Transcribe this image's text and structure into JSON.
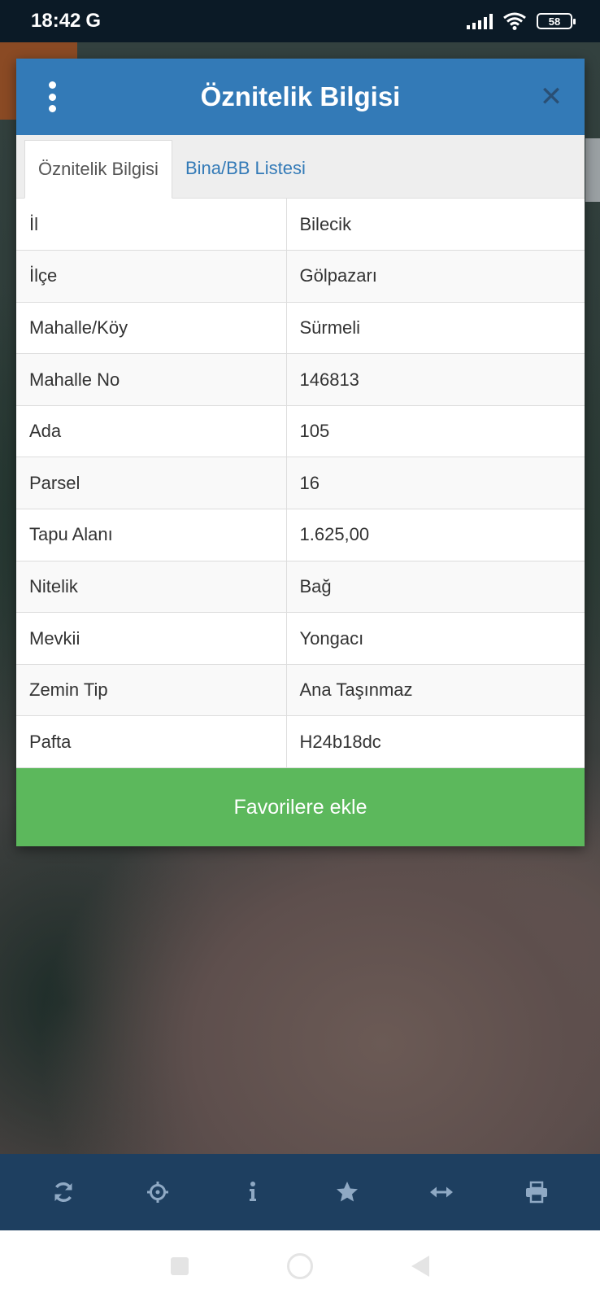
{
  "status_bar": {
    "time": "18:42",
    "carrier_glyph": "G",
    "battery": "58"
  },
  "dialog": {
    "title": "Öznitelik Bilgisi",
    "tabs": [
      {
        "label": "Öznitelik Bilgisi",
        "active": true
      },
      {
        "label": "Bina/BB Listesi",
        "active": false
      }
    ],
    "rows": [
      {
        "key": "İl",
        "value": "Bilecik"
      },
      {
        "key": "İlçe",
        "value": "Gölpazarı"
      },
      {
        "key": "Mahalle/Köy",
        "value": "Sürmeli"
      },
      {
        "key": "Mahalle No",
        "value": "146813"
      },
      {
        "key": "Ada",
        "value": "105"
      },
      {
        "key": "Parsel",
        "value": "16"
      },
      {
        "key": "Tapu Alanı",
        "value": "1.625,00"
      },
      {
        "key": "Nitelik",
        "value": "Bağ"
      },
      {
        "key": "Mevkii",
        "value": "Yongacı"
      },
      {
        "key": "Zemin Tip",
        "value": "Ana Taşınmaz"
      },
      {
        "key": "Pafta",
        "value": "H24b18dc"
      }
    ],
    "favorite_button": "Favorilere ekle"
  },
  "toolbar": {
    "icons": [
      "refresh-icon",
      "crosshair-icon",
      "info-icon",
      "star-icon",
      "measure-icon",
      "print-icon"
    ]
  },
  "colors": {
    "header": "#337ab7",
    "favorite_button": "#5cb85c",
    "toolbar": "#1e3f60",
    "toolbar_icon": "#8fa9c4"
  }
}
